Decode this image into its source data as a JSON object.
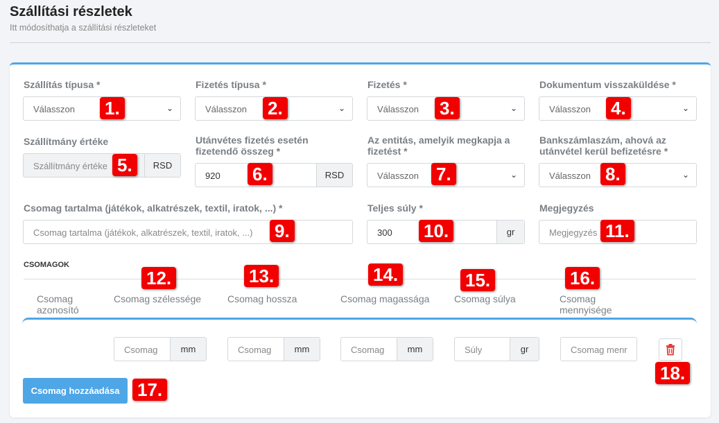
{
  "header": {
    "title": "Szállítási részletek",
    "subtitle": "Itt módosíthatja a szállítási részleteket"
  },
  "form": {
    "shipping_type": {
      "label": "Szállítás típusa *",
      "value": "Válasszon"
    },
    "payment_type": {
      "label": "Fizetés típusa *",
      "value": "Válasszon"
    },
    "payment": {
      "label": "Fizetés *",
      "value": "Válasszon"
    },
    "document_return": {
      "label": "Dokumentum visszaküldése *",
      "value": "Válasszon"
    },
    "shipment_value": {
      "label": "Szállítmány értéke",
      "placeholder": "Szállítmány értéke",
      "unit": "RSD"
    },
    "cod_amount": {
      "label": "Utánvétes fizetés esetén fizetendő összeg *",
      "value": "920",
      "unit": "RSD"
    },
    "payee_entity": {
      "label": "Az entitás, amelyik megkapja a fizetést *",
      "value": "Válasszon"
    },
    "bank_account": {
      "label": "Bankszámlaszám, ahová az utánvétel kerül befizetésre *",
      "value": "Válasszon"
    },
    "package_contents": {
      "label": "Csomag tartalma (játékok, alkatrészek, textil, iratok, ...) *",
      "placeholder": "Csomag tartalma (játékok, alkatrészek, textil, iratok, ...)"
    },
    "total_weight": {
      "label": "Teljes súly *",
      "value": "300",
      "unit": "gr"
    },
    "note": {
      "label": "Megjegyzés",
      "placeholder": "Megjegyzés"
    }
  },
  "packages": {
    "section_title": "CSOMAGOK",
    "columns": [
      "Csomag azonosító",
      "Csomag szélessége",
      "Csomag hossza",
      "Csomag magassága",
      "Csomag súlya",
      "Csomag mennyisége"
    ],
    "row": {
      "width_placeholder": "Csomag",
      "width_unit": "mm",
      "length_placeholder": "Csomag",
      "length_unit": "mm",
      "height_placeholder": "Csomag",
      "height_unit": "mm",
      "weight_placeholder": "Súly",
      "weight_unit": "gr",
      "quantity_placeholder": "Csomag menr"
    },
    "add_button": "Csomag hozzáadása"
  },
  "badges": [
    "1.",
    "2.",
    "3.",
    "4.",
    "5.",
    "6.",
    "7.",
    "8.",
    "9.",
    "10.",
    "11.",
    "12.",
    "13.",
    "14.",
    "15.",
    "16.",
    "17.",
    "18."
  ],
  "colors": {
    "accent": "#4ea6e6",
    "badge": "#f20000",
    "trash": "#e53935"
  }
}
